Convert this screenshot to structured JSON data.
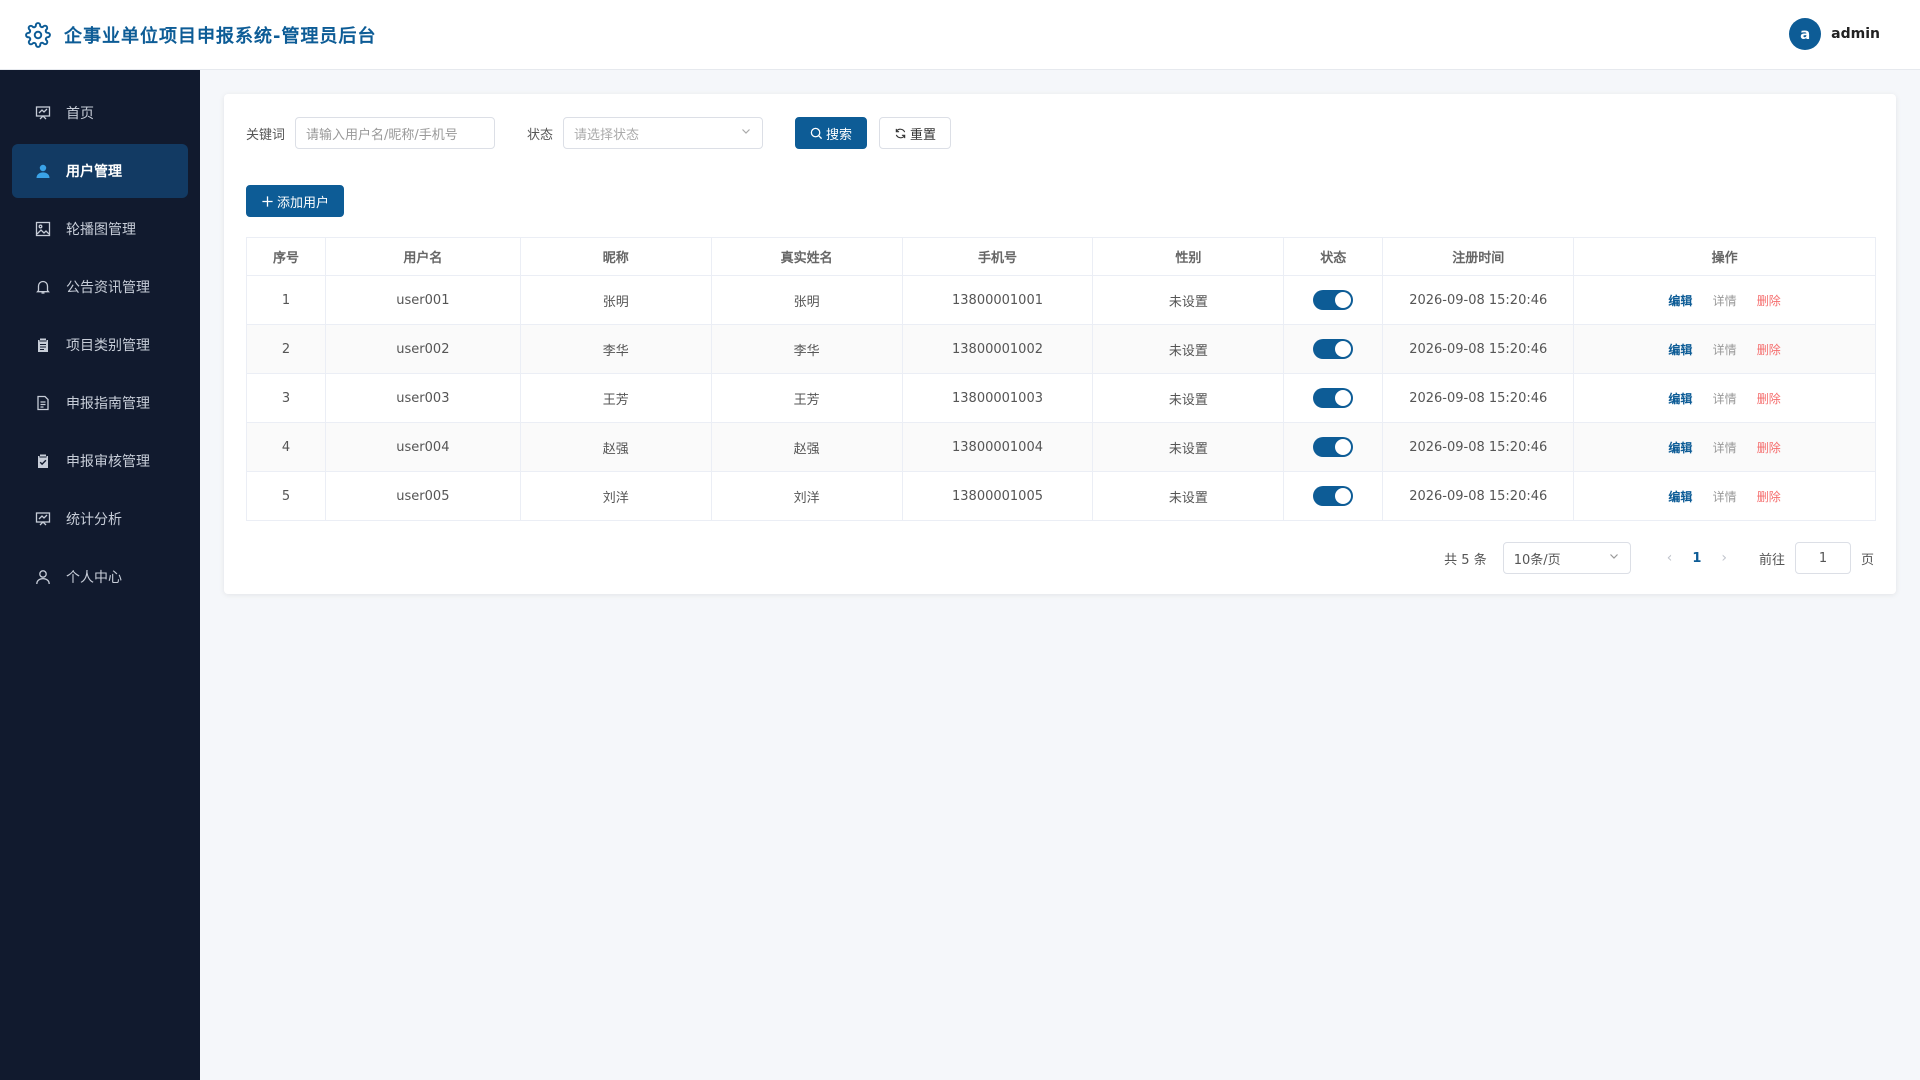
{
  "header": {
    "title": "企事业单位项目申报系统-管理员后台",
    "avatar_letter": "a",
    "username": "admin"
  },
  "sidebar": {
    "items": [
      {
        "label": "首页",
        "icon": "chart-icon",
        "active": false
      },
      {
        "label": "用户管理",
        "icon": "user-icon",
        "active": true
      },
      {
        "label": "轮播图管理",
        "icon": "image-icon",
        "active": false
      },
      {
        "label": "公告资讯管理",
        "icon": "bell-icon",
        "active": false
      },
      {
        "label": "项目类别管理",
        "icon": "clipboard-icon",
        "active": false
      },
      {
        "label": "申报指南管理",
        "icon": "document-icon",
        "active": false
      },
      {
        "label": "申报审核管理",
        "icon": "clipboard-check-icon",
        "active": false
      },
      {
        "label": "统计分析",
        "icon": "chart-icon",
        "active": false
      },
      {
        "label": "个人中心",
        "icon": "user-outline-icon",
        "active": false
      }
    ]
  },
  "filter": {
    "keyword_label": "关键词",
    "keyword_placeholder": "请输入用户名/昵称/手机号",
    "status_label": "状态",
    "status_placeholder": "请选择状态",
    "search_label": "搜索",
    "reset_label": "重置"
  },
  "toolbar": {
    "add_label": "添加用户"
  },
  "table": {
    "columns": [
      "序号",
      "用户名",
      "昵称",
      "真实姓名",
      "手机号",
      "性别",
      "状态",
      "注册时间",
      "操作"
    ],
    "rows": [
      {
        "index": "1",
        "username": "user001",
        "nickname": "张明",
        "realname": "张明",
        "phone": "13800001001",
        "gender": "未设置",
        "enabled": true,
        "time": "2026-09-08 15:20:46"
      },
      {
        "index": "2",
        "username": "user002",
        "nickname": "李华",
        "realname": "李华",
        "phone": "13800001002",
        "gender": "未设置",
        "enabled": true,
        "time": "2026-09-08 15:20:46"
      },
      {
        "index": "3",
        "username": "user003",
        "nickname": "王芳",
        "realname": "王芳",
        "phone": "13800001003",
        "gender": "未设置",
        "enabled": true,
        "time": "2026-09-08 15:20:46"
      },
      {
        "index": "4",
        "username": "user004",
        "nickname": "赵强",
        "realname": "赵强",
        "phone": "13800001004",
        "gender": "未设置",
        "enabled": true,
        "time": "2026-09-08 15:20:46"
      },
      {
        "index": "5",
        "username": "user005",
        "nickname": "刘洋",
        "realname": "刘洋",
        "phone": "13800001005",
        "gender": "未设置",
        "enabled": true,
        "time": "2026-09-08 15:20:46"
      }
    ],
    "actions": {
      "edit": "编辑",
      "detail": "详情",
      "delete": "删除"
    }
  },
  "pagination": {
    "total_text": "共 5 条",
    "page_size": "10条/页",
    "current_page": "1",
    "goto_label": "前往",
    "goto_value": "1",
    "page_suffix": "页"
  },
  "colors": {
    "primary": "#0d5c96",
    "sidebar_bg": "#111a2e",
    "danger": "#f56c6c"
  }
}
